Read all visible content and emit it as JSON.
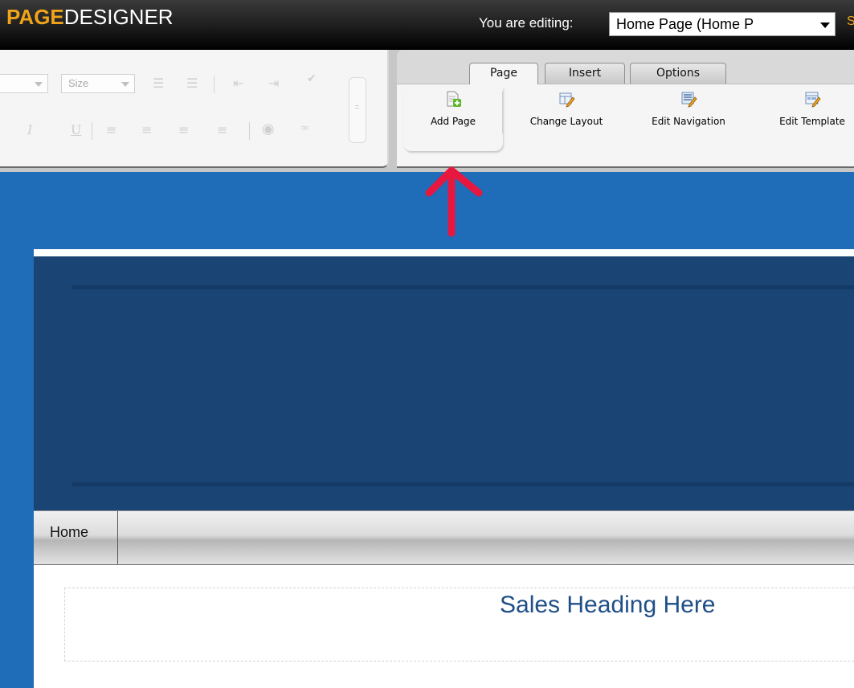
{
  "brand": {
    "logo_part1": "PAGE",
    "logo_part2": "DESIGNER"
  },
  "header": {
    "editing_label": "You are editing:",
    "page_select_value": "Home Page (Home P",
    "extra_link": "S"
  },
  "format_toolbar": {
    "size_select": "Size",
    "font_select": ""
  },
  "ribbon": {
    "tabs": [
      {
        "label": "Page",
        "active": true
      },
      {
        "label": "Insert",
        "active": false
      },
      {
        "label": "Options",
        "active": false
      }
    ],
    "buttons": [
      {
        "label": "Add Page",
        "icon": "add-page-icon"
      },
      {
        "label": "Change Layout",
        "icon": "change-layout-icon"
      },
      {
        "label": "Edit Navigation",
        "icon": "edit-navigation-icon"
      },
      {
        "label": "Edit Template",
        "icon": "edit-template-icon"
      }
    ]
  },
  "annotation": {
    "arrow_color": "#e8173f"
  },
  "site": {
    "nav": [
      {
        "label": "Home"
      }
    ],
    "sales_heading": "Sales Heading Here"
  },
  "colors": {
    "brand_orange": "#f0a419",
    "canvas_blue": "#1f6cb9",
    "banner_navy": "#1a4474",
    "heading_blue": "#1f4f88"
  }
}
